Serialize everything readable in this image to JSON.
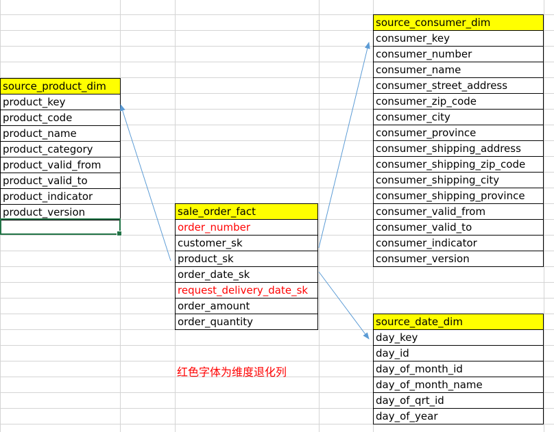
{
  "tables": {
    "product": {
      "title": "source_product_dim",
      "rows": [
        "product_key",
        "product_code",
        "product_name",
        "product_category",
        "product_valid_from",
        "product_valid_to",
        "product_indicator",
        "product_version"
      ]
    },
    "fact": {
      "title": "sale_order_fact",
      "rows": [
        "order_number",
        "customer_sk",
        "product_sk",
        "order_date_sk",
        "request_delivery_date_sk",
        "order_amount",
        "order_quantity"
      ],
      "degenerate_rows": [
        0,
        4
      ]
    },
    "consumer": {
      "title": "source_consumer_dim",
      "rows": [
        "consumer_key",
        "consumer_number",
        "consumer_name",
        "consumer_street_address",
        "consumer_zip_code",
        "consumer_city",
        "consumer_province",
        "consumer_shipping_address",
        "consumer_shipping_zip_code",
        "consumer_shipping_city",
        "consumer_shipping_province",
        "consumer_valid_from",
        "consumer_valid_to",
        "consumer_indicator",
        "consumer_version"
      ]
    },
    "date": {
      "title": "source_date_dim",
      "rows": [
        "day_key",
        "day_id",
        "day_of_month_id",
        "day_of_month_name",
        "day_of_qrt_id",
        "day_of_year"
      ]
    }
  },
  "note": "红色字体为维度退化列",
  "colors": {
    "header_fill": "#ffff00",
    "degenerate_text": "#ff0000",
    "arrow": "#5b9bd5",
    "gridline": "#d4d4d4",
    "selection": "#217346"
  }
}
